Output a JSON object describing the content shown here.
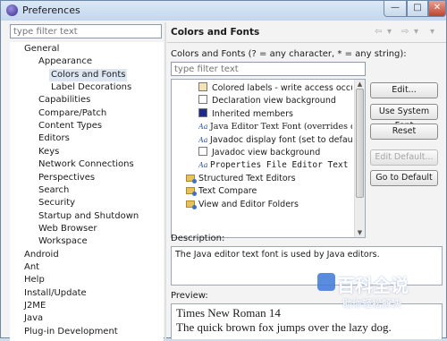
{
  "window": {
    "title": "Preferences"
  },
  "left": {
    "filter_placeholder": "type filter text",
    "tree": [
      {
        "label": "General",
        "depth": 0
      },
      {
        "label": "Appearance",
        "depth": 1
      },
      {
        "label": "Colors and Fonts",
        "depth": 2,
        "selected": true
      },
      {
        "label": "Label Decorations",
        "depth": 2
      },
      {
        "label": "Capabilities",
        "depth": 1
      },
      {
        "label": "Compare/Patch",
        "depth": 1
      },
      {
        "label": "Content Types",
        "depth": 1
      },
      {
        "label": "Editors",
        "depth": 1
      },
      {
        "label": "Keys",
        "depth": 1
      },
      {
        "label": "Network Connections",
        "depth": 1
      },
      {
        "label": "Perspectives",
        "depth": 1
      },
      {
        "label": "Search",
        "depth": 1
      },
      {
        "label": "Security",
        "depth": 1
      },
      {
        "label": "Startup and Shutdown",
        "depth": 1
      },
      {
        "label": "Web Browser",
        "depth": 1
      },
      {
        "label": "Workspace",
        "depth": 1
      },
      {
        "label": "Android",
        "depth": 0
      },
      {
        "label": "Ant",
        "depth": 0
      },
      {
        "label": "Help",
        "depth": 0
      },
      {
        "label": "Install/Update",
        "depth": 0
      },
      {
        "label": "J2ME",
        "depth": 0
      },
      {
        "label": "Java",
        "depth": 0
      },
      {
        "label": "Plug-in Development",
        "depth": 0
      }
    ]
  },
  "right": {
    "title": "Colors and Fonts",
    "nav": {
      "back": "⇦",
      "forward": "⇨",
      "dropdown": "▾"
    },
    "filter_hint": "Colors and Fonts (? = any character, * = any string):",
    "filter_placeholder": "type filter text",
    "list": [
      {
        "label": "Colored labels - write access occurrer",
        "kind": "color",
        "color": "#f5e3b3",
        "indent": 1
      },
      {
        "label": "Declaration view background",
        "kind": "color",
        "color": "#ffffff",
        "indent": 1
      },
      {
        "label": "Inherited members",
        "kind": "color",
        "color": "#1c2c8c",
        "indent": 1
      },
      {
        "label": "Java Editor Text Font (overrides default: Text",
        "kind": "font",
        "font": "serif",
        "indent": 1
      },
      {
        "label": "Javadoc display font (set to default: D",
        "kind": "font",
        "font": "sans",
        "indent": 1
      },
      {
        "label": "Javadoc view background",
        "kind": "color",
        "color": "#ffffff",
        "indent": 1
      },
      {
        "label": "Properties File Editor Text Font",
        "kind": "font",
        "font": "mono",
        "indent": 1
      },
      {
        "label": "Structured Text Editors",
        "kind": "folder",
        "indent": 0
      },
      {
        "label": "Text Compare",
        "kind": "folder",
        "indent": 0
      },
      {
        "label": "View and Editor Folders",
        "kind": "folder",
        "indent": 0
      }
    ],
    "buttons": {
      "edit": "Edit...",
      "use_system_font": "Use System Font",
      "reset": "Reset",
      "edit_default": "Edit Default...",
      "go_to_default": "Go to Default"
    },
    "description_label": "Description:",
    "description_text": "The Java editor text font is used by Java editors.",
    "preview_label": "Preview:",
    "preview_lines": [
      "Times New Roman 14",
      "The quick brown fox jumps over the lazy dog."
    ]
  },
  "watermark": {
    "main": "百科全说",
    "sub": "助你轻松解决"
  }
}
